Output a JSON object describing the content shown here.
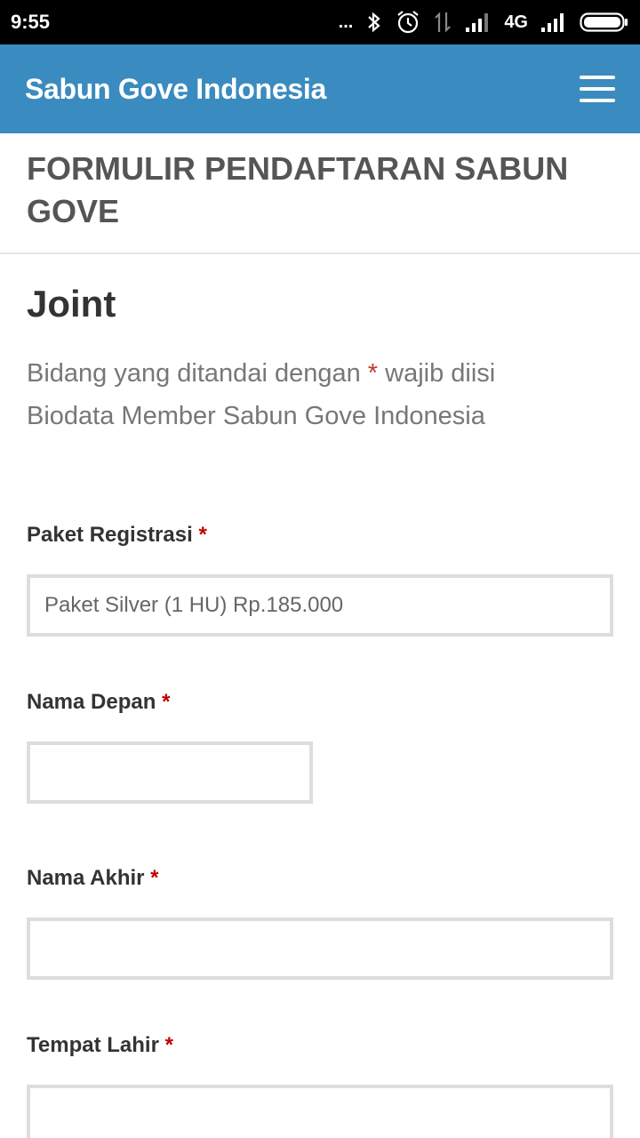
{
  "status_bar": {
    "time": "9:55",
    "dots": "...",
    "network_type": "4G",
    "icons": [
      "bluetooth-icon",
      "alarm-icon",
      "data-transfer-icon",
      "signal-icon",
      "signal-icon",
      "battery-icon"
    ]
  },
  "app_bar": {
    "title": "Sabun Gove Indonesia",
    "menu_icon": "hamburger-menu-icon",
    "color": "#3a8bbf"
  },
  "page": {
    "title": "FORMULIR PENDAFTARAN SABUN GOVE"
  },
  "form": {
    "title": "Joint",
    "required_note_prefix": "Bidang yang ditandai dengan ",
    "required_marker": "*",
    "required_note_suffix": " wajib diisi",
    "description": "Biodata Member Sabun Gove Indonesia",
    "fields": [
      {
        "label": "Paket Registrasi",
        "required": "*",
        "value": "Paket Silver (1 HU) Rp.185.000"
      },
      {
        "label": "Nama Depan",
        "required": "*",
        "value": ""
      },
      {
        "label": "Nama Akhir",
        "required": "*",
        "value": ""
      },
      {
        "label": "Tempat Lahir",
        "required": "*",
        "value": ""
      }
    ]
  }
}
